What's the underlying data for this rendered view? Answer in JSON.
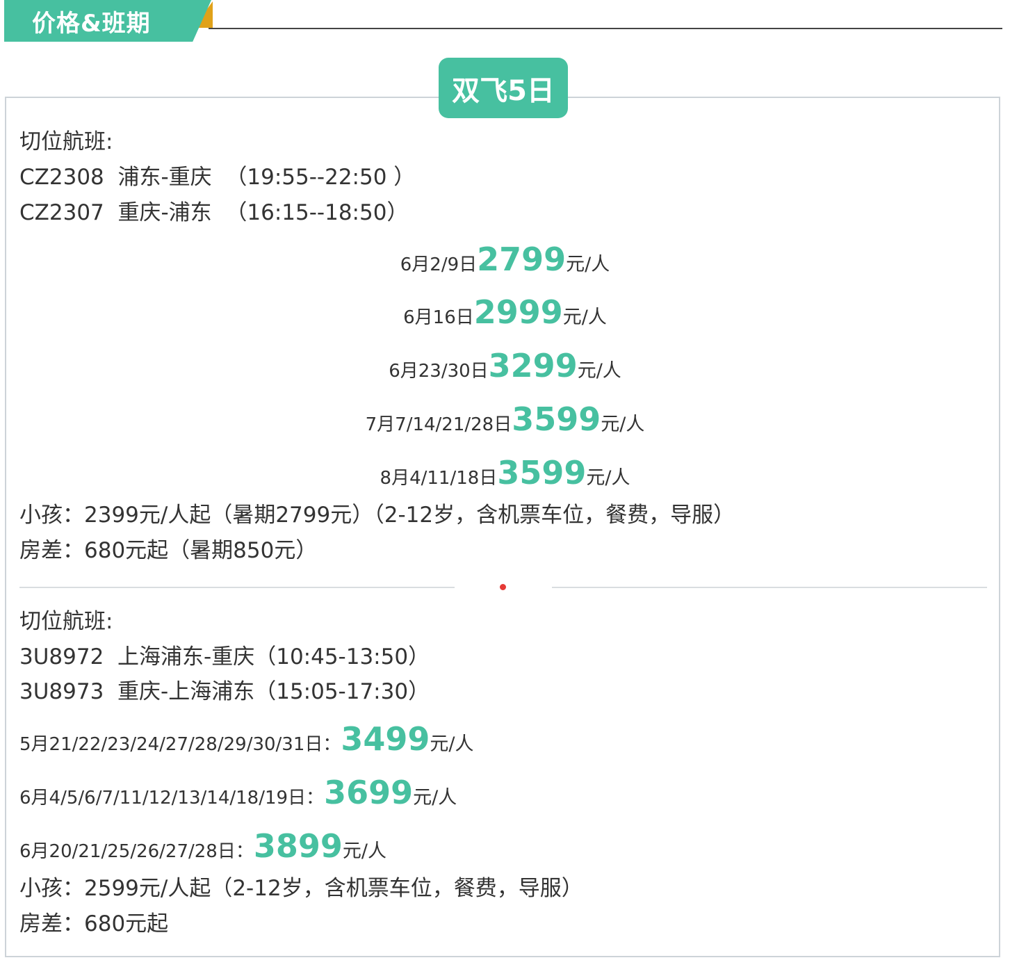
{
  "header": {
    "title": "价格&班期"
  },
  "badge": {
    "label": "双飞5日"
  },
  "section1": {
    "flights_title": "切位航班:",
    "flights": [
      {
        "no": "CZ2308",
        "route": "浦东-重庆",
        "time": "（19:55--22:50 ）"
      },
      {
        "no": "CZ2307",
        "route": "重庆-浦东",
        "time": "（16:15--18:50）"
      }
    ],
    "prices": [
      {
        "date": "6月2/9日",
        "price": "2799",
        "unit": "元/人"
      },
      {
        "date": "6月16日",
        "price": "2999",
        "unit": "元/人"
      },
      {
        "date": "6月23/30日",
        "price": "3299",
        "unit": "元/人"
      },
      {
        "date": "7月7/14/21/28日",
        "price": "3599",
        "unit": "元/人"
      },
      {
        "date": "8月4/11/18日",
        "price": "3599",
        "unit": "元/人"
      }
    ],
    "child": "小孩：2399元/人起（暑期2799元）（2-12岁，含机票车位，餐费，导服）",
    "room": "房差：680元起（暑期850元）"
  },
  "section2": {
    "flights_title": "切位航班:",
    "flights": [
      {
        "no": "3U8972",
        "route": "上海浦东-重庆（10:45-13:50）"
      },
      {
        "no": "3U8973",
        "route": "重庆-上海浦东（15:05-17:30）"
      }
    ],
    "prices": [
      {
        "date": "5月21/22/23/24/27/28/29/30/31日：",
        "price": "3499",
        "unit": "元/人"
      },
      {
        "date": "6月4/5/6/7/11/12/13/14/18/19日：",
        "price": "3699",
        "unit": "元/人"
      },
      {
        "date": "6月20/21/25/26/27/28日：",
        "price": "3899",
        "unit": "元/人"
      }
    ],
    "child": "小孩：2599元/人起（2-12岁，含机票车位，餐费，导服）",
    "room": "房差：680元起"
  },
  "colors": {
    "accent": "#47c0a0",
    "corner": "#e0a21a",
    "dot": "#e53935"
  }
}
